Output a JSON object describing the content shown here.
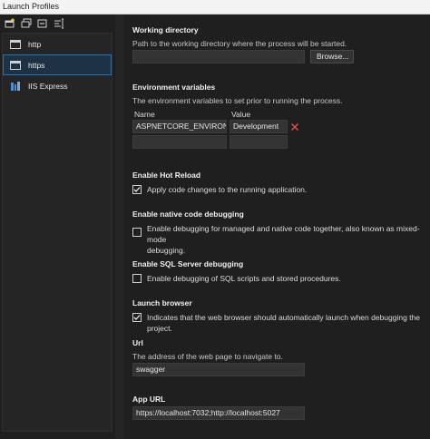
{
  "window": {
    "title": "Launch Profiles"
  },
  "sidebar": {
    "toolbar": [
      {
        "icon": "new-profile-icon"
      },
      {
        "icon": "duplicate-profile-icon"
      },
      {
        "icon": "remove-profile-icon"
      },
      {
        "icon": "rename-profile-icon"
      }
    ],
    "profiles": [
      {
        "label": "http",
        "icon": "browser-window-icon"
      },
      {
        "label": "https",
        "icon": "browser-window-icon",
        "selected": true
      },
      {
        "label": "IIS Express",
        "icon": "iis-express-icon"
      }
    ]
  },
  "working_directory": {
    "title": "Working directory",
    "description": "Path to the working directory where the process will be started.",
    "value": "",
    "browse_label": "Browse..."
  },
  "environment_variables": {
    "title": "Environment variables",
    "description": "The environment variables to set prior to running the process.",
    "columns": [
      "Name",
      "Value"
    ],
    "rows": [
      {
        "name": "ASPNETCORE_ENVIRONMENT",
        "value": "Development"
      },
      {
        "name": "",
        "value": ""
      }
    ]
  },
  "hot_reload": {
    "title": "Enable Hot Reload",
    "label": "Apply code changes to the running application.",
    "checked": true
  },
  "native_debugging": {
    "title": "Enable native code debugging",
    "label_line1": "Enable debugging for managed and native code together, also known as mixed-mode",
    "label_line2": "debugging.",
    "checked": false
  },
  "sql_debugging": {
    "title": "Enable SQL Server debugging",
    "label": "Enable debugging of SQL scripts and stored procedures.",
    "checked": false
  },
  "launch_browser": {
    "title": "Launch browser",
    "label": "Indicates that the web browser should automatically launch when debugging the project.",
    "checked": true
  },
  "url": {
    "title": "Url",
    "description": "The address of the web page to navigate to.",
    "value": "swagger"
  },
  "app_url": {
    "title": "App URL",
    "value": "https://localhost:7032;http://localhost:5027"
  },
  "colors": {
    "background": "#1f1f1f",
    "selected_bg": "#1e3246",
    "selected_border": "#3a6d99",
    "delete_red": "#e04848",
    "field_bg": "#333333"
  }
}
